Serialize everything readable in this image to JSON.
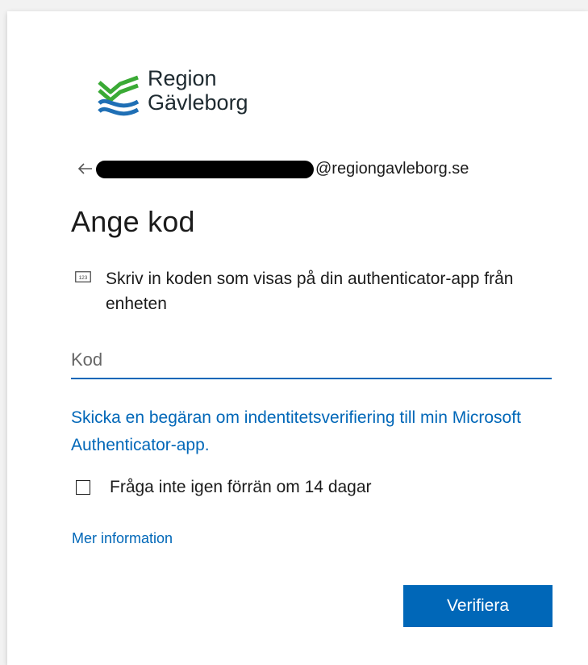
{
  "logo": {
    "line1": "Region",
    "line2": "Gävleborg",
    "colors": {
      "green": "#3aaa35",
      "blue": "#1f6fb5"
    }
  },
  "identity": {
    "back_icon": "arrow-left-icon",
    "email_domain": "@regiongavleborg.se"
  },
  "title": "Ange kod",
  "instruction": {
    "icon": "numeric-keypad-icon",
    "icon_text": "123",
    "text": "Skriv in koden som visas på din authenticator-app från enheten"
  },
  "code_input": {
    "placeholder": "Kod",
    "value": ""
  },
  "authenticator_link": "Skicka en begäran om indentitetsverifiering till min Microsoft Authenticator-app.",
  "remember": {
    "label": "Fråga inte igen förrän om 14 dagar",
    "checked": false
  },
  "more_info_link": "Mer information",
  "verify_button": "Verifiera",
  "colors": {
    "accent": "#0067b8",
    "text": "#1b1b1b",
    "background": "#f2f2f2",
    "card": "#ffffff"
  }
}
